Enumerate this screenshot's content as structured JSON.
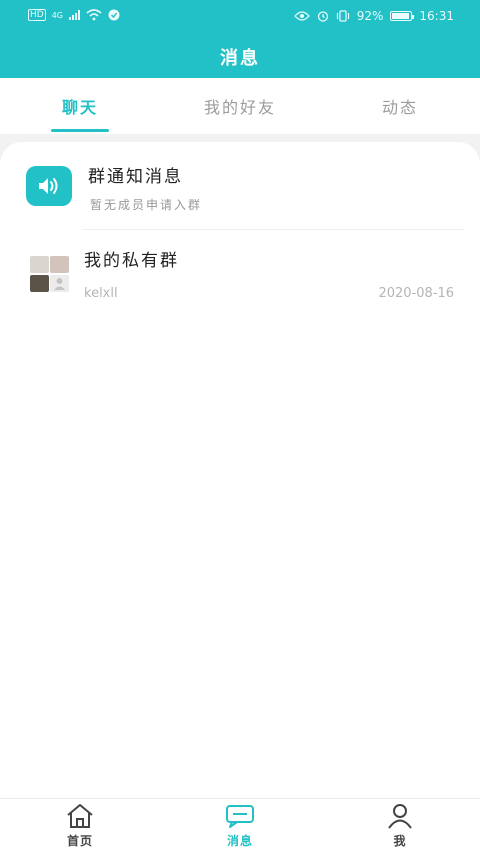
{
  "status_bar": {
    "left_badge": "HD",
    "network": "4G",
    "battery_percent": "92%",
    "battery_level": 0.92,
    "time": "16:31"
  },
  "header": {
    "title": "消息"
  },
  "tabs": [
    {
      "label": "聊天",
      "active": true
    },
    {
      "label": "我的好友",
      "active": false
    },
    {
      "label": "动态",
      "active": false
    }
  ],
  "conversations": [
    {
      "title": "群通知消息",
      "subtitle": "暂无成员申请入群",
      "icon": "speaker-icon"
    },
    {
      "title": "我的私有群",
      "subtitle": "kelxll",
      "date": "2020-08-16",
      "icon": "group-avatar"
    }
  ],
  "bottom_nav": [
    {
      "label": "首页",
      "icon": "home-icon",
      "active": false
    },
    {
      "label": "消息",
      "icon": "message-icon",
      "active": true
    },
    {
      "label": "我",
      "icon": "person-icon",
      "active": false
    }
  ],
  "colors": {
    "accent": "#22c0c7",
    "text": "#222222",
    "muted": "#999999"
  }
}
